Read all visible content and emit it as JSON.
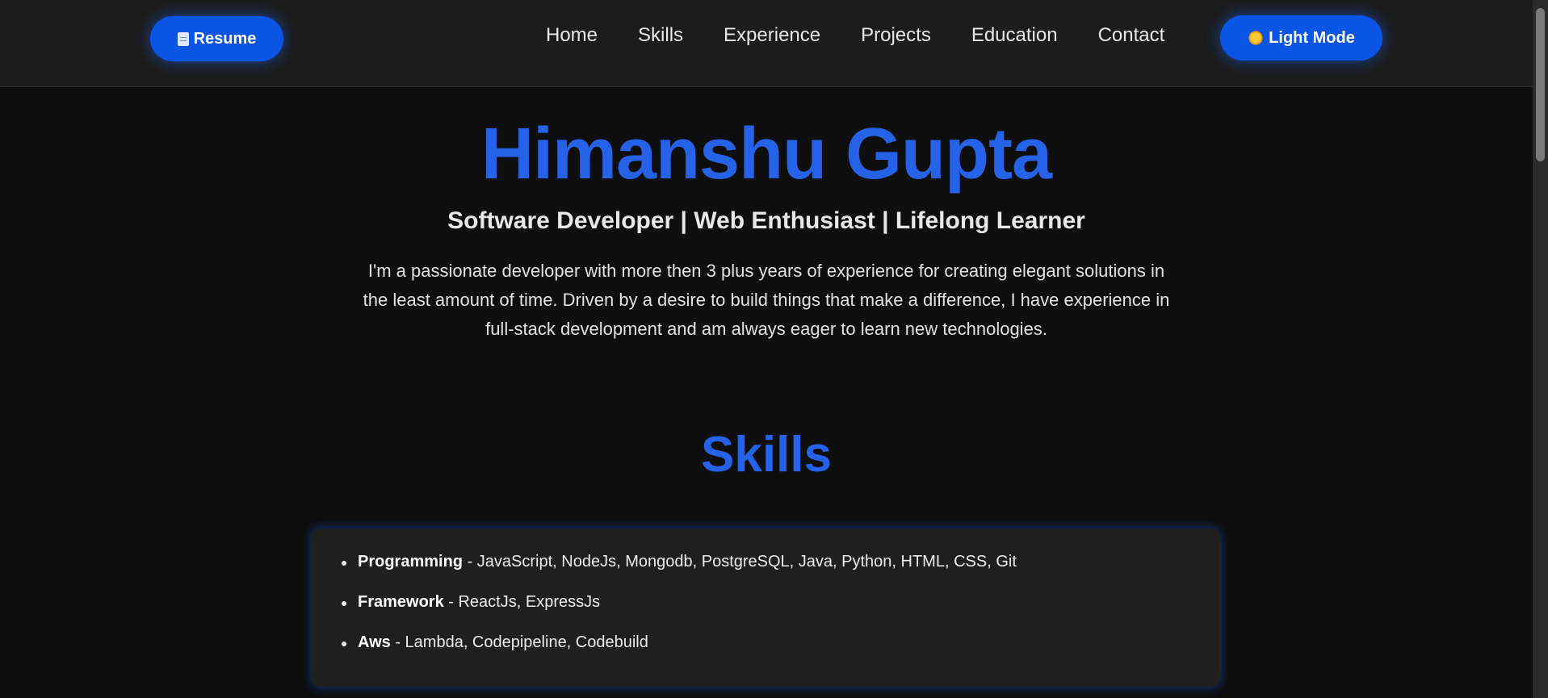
{
  "navbar": {
    "resume_label": "Resume",
    "resume_icon": "document-icon",
    "links": [
      "Home",
      "Skills",
      "Experience",
      "Projects",
      "Education",
      "Contact"
    ],
    "theme_label": "Light Mode",
    "theme_icon": "sun-icon"
  },
  "hero": {
    "name": "Himanshu Gupta",
    "tagline": "Software Developer | Web Enthusiast | Lifelong Learner",
    "bio": "I'm a passionate developer with more then 3 plus years of experience for creating elegant solutions in the least amount of time. Driven by a desire to build things that make a difference, I have experience in full-stack development and am always eager to learn new technologies."
  },
  "skills": {
    "title": "Skills",
    "items": [
      {
        "category": "Programming",
        "values": " - JavaScript, NodeJs, Mongodb, PostgreSQL, Java, Python, HTML, CSS, Git"
      },
      {
        "category": "Framework",
        "values": " - ReactJs, ExpressJs"
      },
      {
        "category": "Aws",
        "values": " - Lambda, Codepipeline, Codebuild"
      }
    ]
  },
  "colors": {
    "accent": "#2662e8",
    "button": "#0b55e6",
    "background": "#0e0e0e",
    "navbar": "#1c1c1c",
    "card": "#1f1f1f"
  }
}
